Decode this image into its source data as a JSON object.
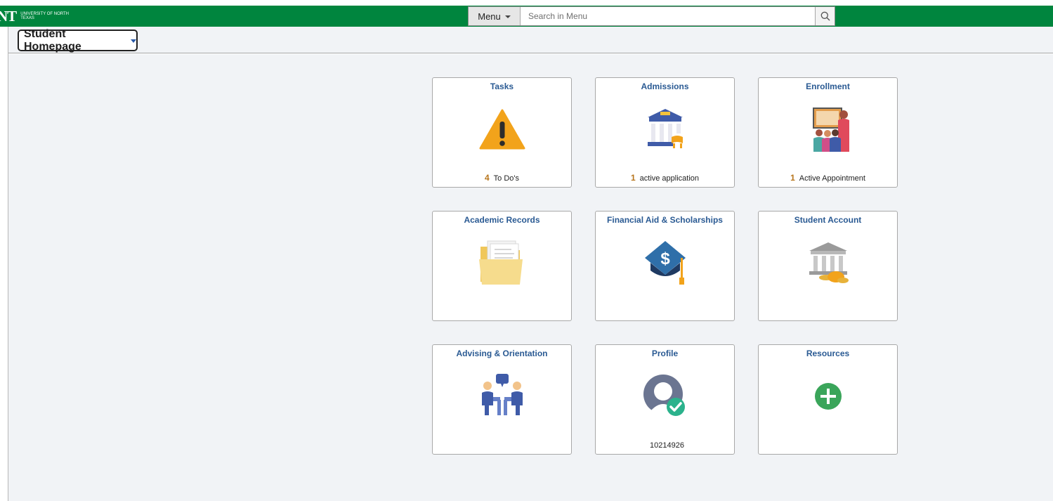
{
  "topbar": {
    "logo_mark": "NT",
    "logo_text": "University of North Texas",
    "menu_label": "Menu",
    "search_placeholder": "Search in Menu"
  },
  "homepage_selector": {
    "label": "Student Homepage"
  },
  "tiles": [
    {
      "title": "Tasks",
      "count": "4",
      "footer": "To Do's",
      "icon": "warning-icon"
    },
    {
      "title": "Admissions",
      "count": "1",
      "footer": "active application",
      "icon": "university-building-icon"
    },
    {
      "title": "Enrollment",
      "count": "1",
      "footer": "Active Appointment",
      "icon": "classroom-icon"
    },
    {
      "title": "Academic Records",
      "count": "",
      "footer": "",
      "icon": "folder-documents-icon"
    },
    {
      "title": "Financial Aid & Scholarships",
      "count": "",
      "footer": "",
      "icon": "graduation-cap-dollar-icon"
    },
    {
      "title": "Student Account",
      "count": "",
      "footer": "",
      "icon": "bank-coins-icon"
    },
    {
      "title": "Advising & Orientation",
      "count": "",
      "footer": "",
      "icon": "advising-people-icon"
    },
    {
      "title": "Profile",
      "count": "",
      "footer": "10214926",
      "icon": "profile-check-icon"
    },
    {
      "title": "Resources",
      "count": "",
      "footer": "",
      "icon": "plus-circle-icon"
    }
  ],
  "colors": {
    "brand_green": "#00853e",
    "tile_title": "#2a5a93",
    "count_orange": "#b7751c"
  }
}
